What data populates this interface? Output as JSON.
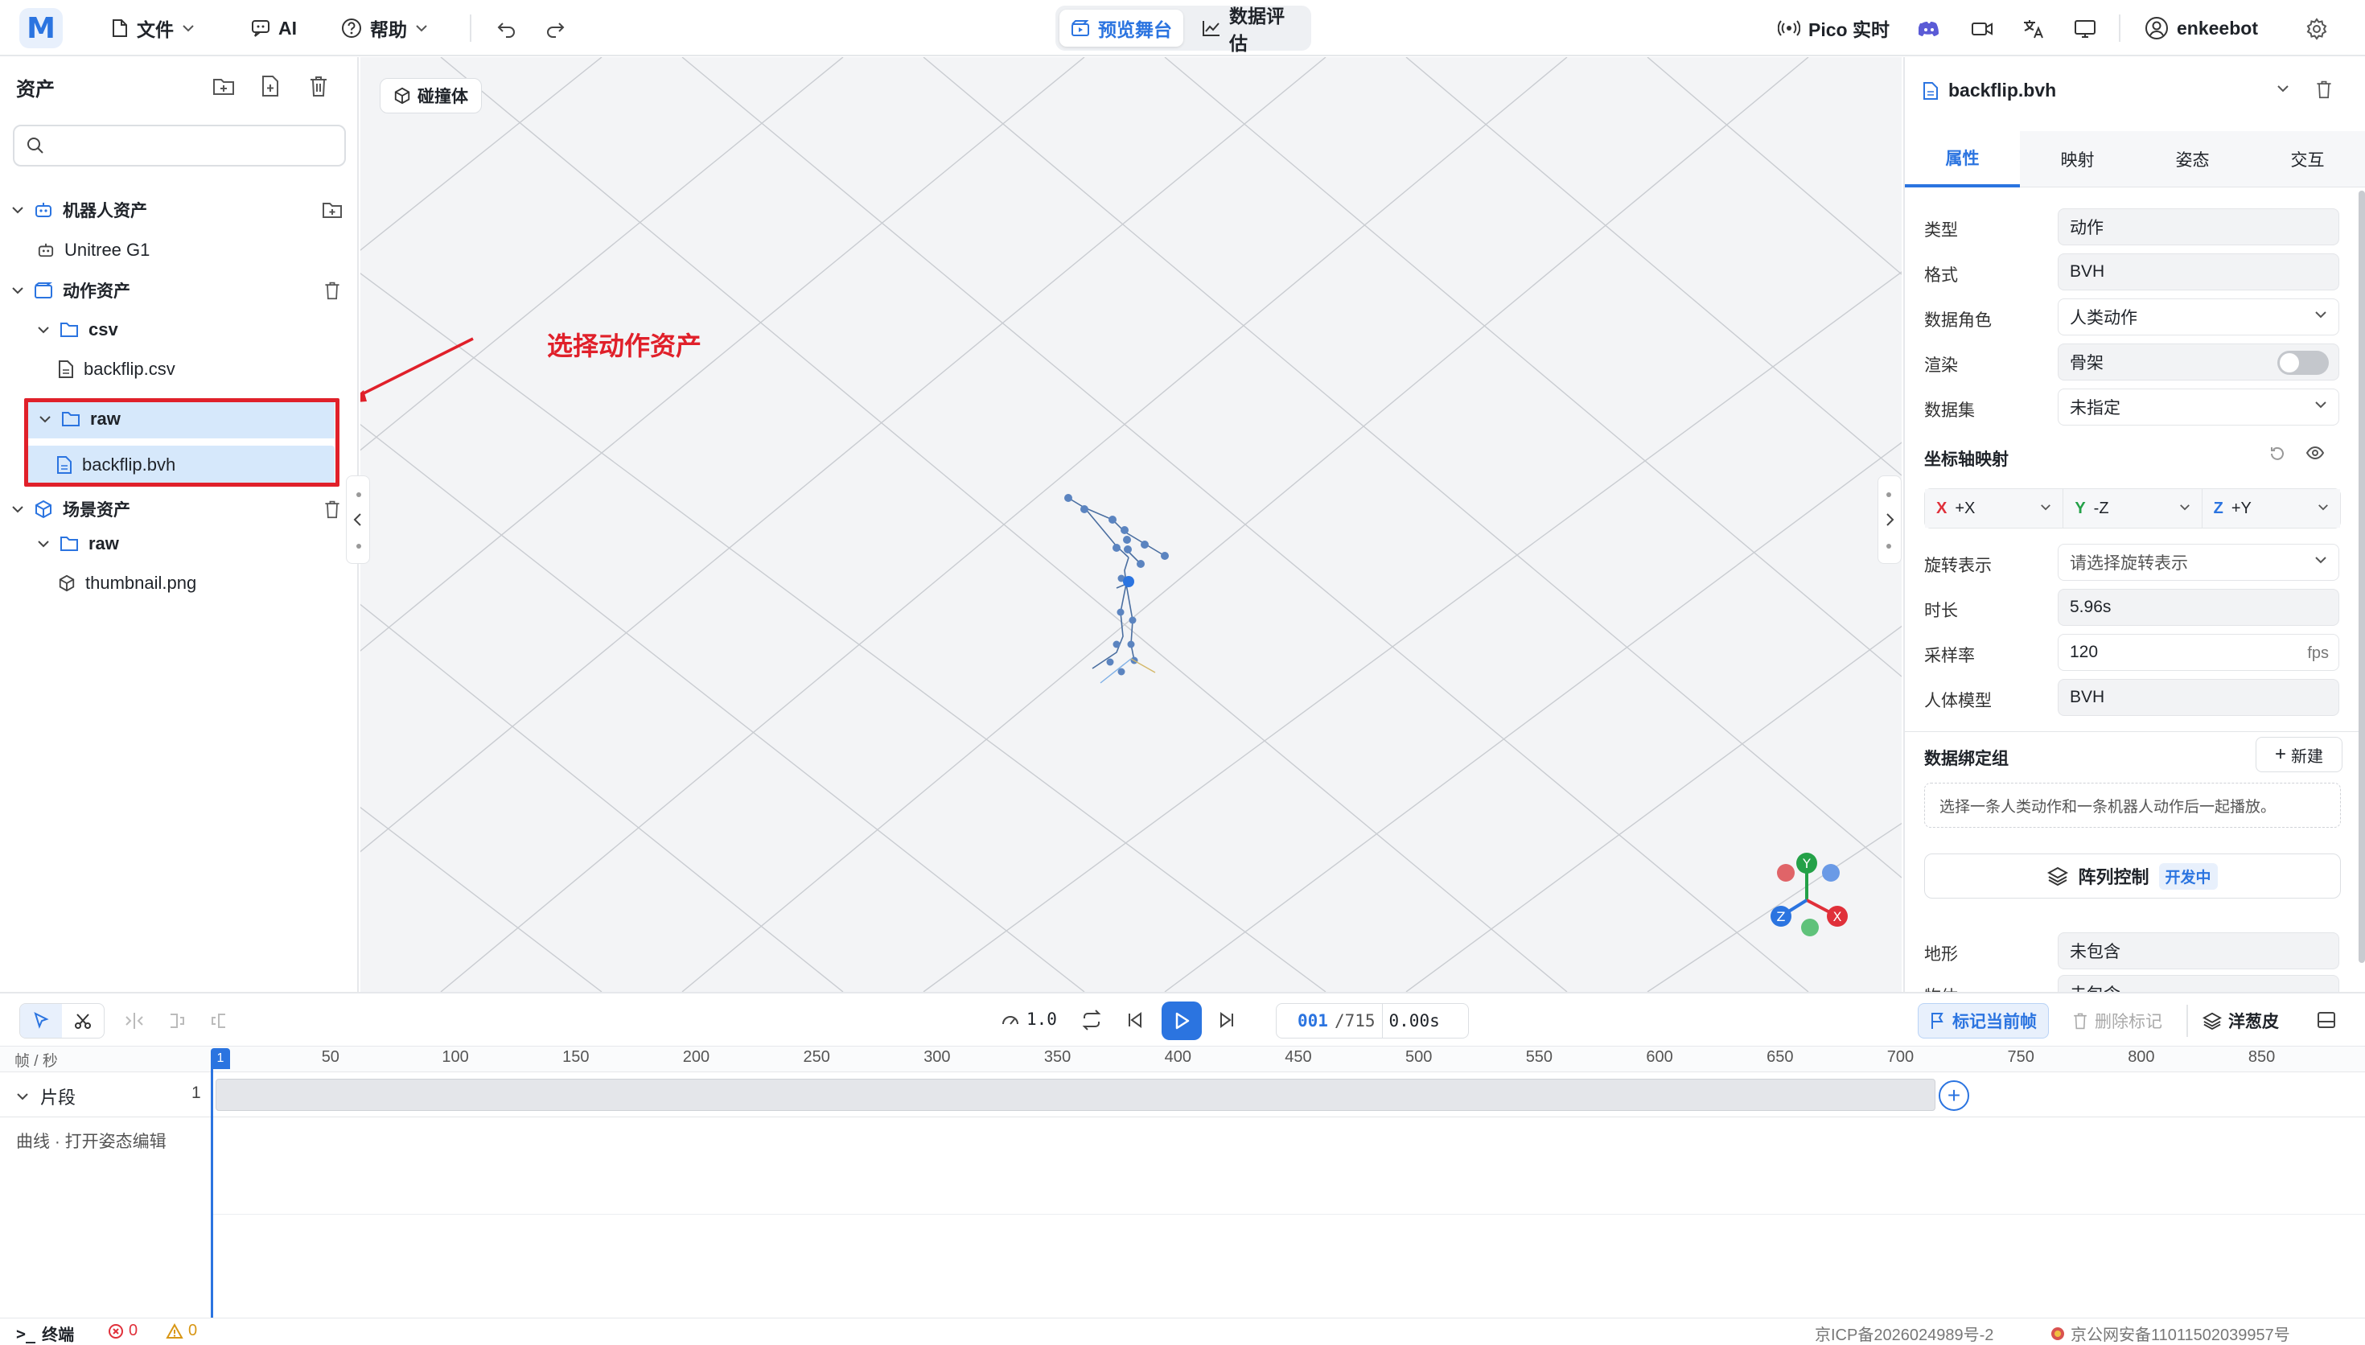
{
  "topbar": {
    "logo": "M",
    "file_label": "文件",
    "ai_label": "AI",
    "help_label": "帮助",
    "tab_preview": "预览舞台",
    "tab_eval": "数据评估",
    "pico_label": "Pico 实时",
    "user_name": "enkeebot",
    "accent": "#2b74e0"
  },
  "assets": {
    "title": "资产",
    "search_placeholder": "",
    "tree": [
      {
        "label": "机器人资产",
        "level": 0,
        "type": "group"
      },
      {
        "label": "Unitree G1",
        "level": 1,
        "type": "robot"
      },
      {
        "label": "动作资产",
        "level": 0,
        "type": "group"
      },
      {
        "label": "csv",
        "level": 1,
        "type": "folder"
      },
      {
        "label": "backflip.csv",
        "level": 2,
        "type": "file"
      },
      {
        "label": "raw",
        "level": 1,
        "type": "folder"
      },
      {
        "label": "backflip.bvh",
        "level": 2,
        "type": "file",
        "selected": true
      },
      {
        "label": "场景资产",
        "level": 0,
        "type": "group"
      },
      {
        "label": "raw",
        "level": 1,
        "type": "folder"
      },
      {
        "label": "thumbnail.png",
        "level": 2,
        "type": "mesh"
      }
    ]
  },
  "viewport": {
    "collider_label": "碰撞体",
    "annotation": "选择动作资产"
  },
  "inspector": {
    "file_name": "backflip.bvh",
    "tabs": [
      "属性",
      "映射",
      "姿态",
      "交互"
    ],
    "active_tab": "属性",
    "type_label": "类型",
    "type_value": "动作",
    "format_label": "格式",
    "format_value": "BVH",
    "role_label": "数据角色",
    "role_value": "人类动作",
    "render_label": "渲染",
    "render_value": "骨架",
    "dataset_label": "数据集",
    "dataset_value": "未指定",
    "axis_title": "坐标轴映射",
    "axis_x": "X",
    "axis_x_value": "+X",
    "axis_y": "Y",
    "axis_y_value": "-Z",
    "axis_z": "Z",
    "axis_z_value": "+Y",
    "rotation_label": "旋转表示",
    "rotation_placeholder": "请选择旋转表示",
    "duration_label": "时长",
    "duration_value": "5.96s",
    "rate_label": "采样率",
    "rate_value": "120",
    "rate_unit": "fps",
    "model_label": "人体模型",
    "model_value": "BVH",
    "binding_title": "数据绑定组",
    "new_label": "新建",
    "binding_hint": "选择一条人类动作和一条机器人动作后一起播放。",
    "array_label": "阵列控制",
    "array_badge": "开发中",
    "terrain_label": "地形",
    "terrain_value": "未包含",
    "object_label": "物体",
    "object_value": "未包含"
  },
  "timeline": {
    "speed": "1.0",
    "frame_current": "001",
    "frame_total": "/715",
    "time": "0.00s",
    "mark_label": "标记当前帧",
    "delete_mark_label": "删除标记",
    "onion_label": "洋葱皮",
    "ruler_unit": "帧 / 秒",
    "ticks": [
      "1",
      "50",
      "100",
      "150",
      "200",
      "250",
      "300",
      "350",
      "400",
      "450",
      "500",
      "550",
      "600",
      "650",
      "700",
      "750",
      "800",
      "850"
    ],
    "track_label": "片段",
    "track_count": "1",
    "curve_label": "曲线 · 打开姿态编辑"
  },
  "statusbar": {
    "terminal_label": "终端",
    "errors": "0",
    "warnings": "0",
    "icp": "京ICP备2026024989号-2",
    "police": "京公网安备11011502039957号"
  }
}
